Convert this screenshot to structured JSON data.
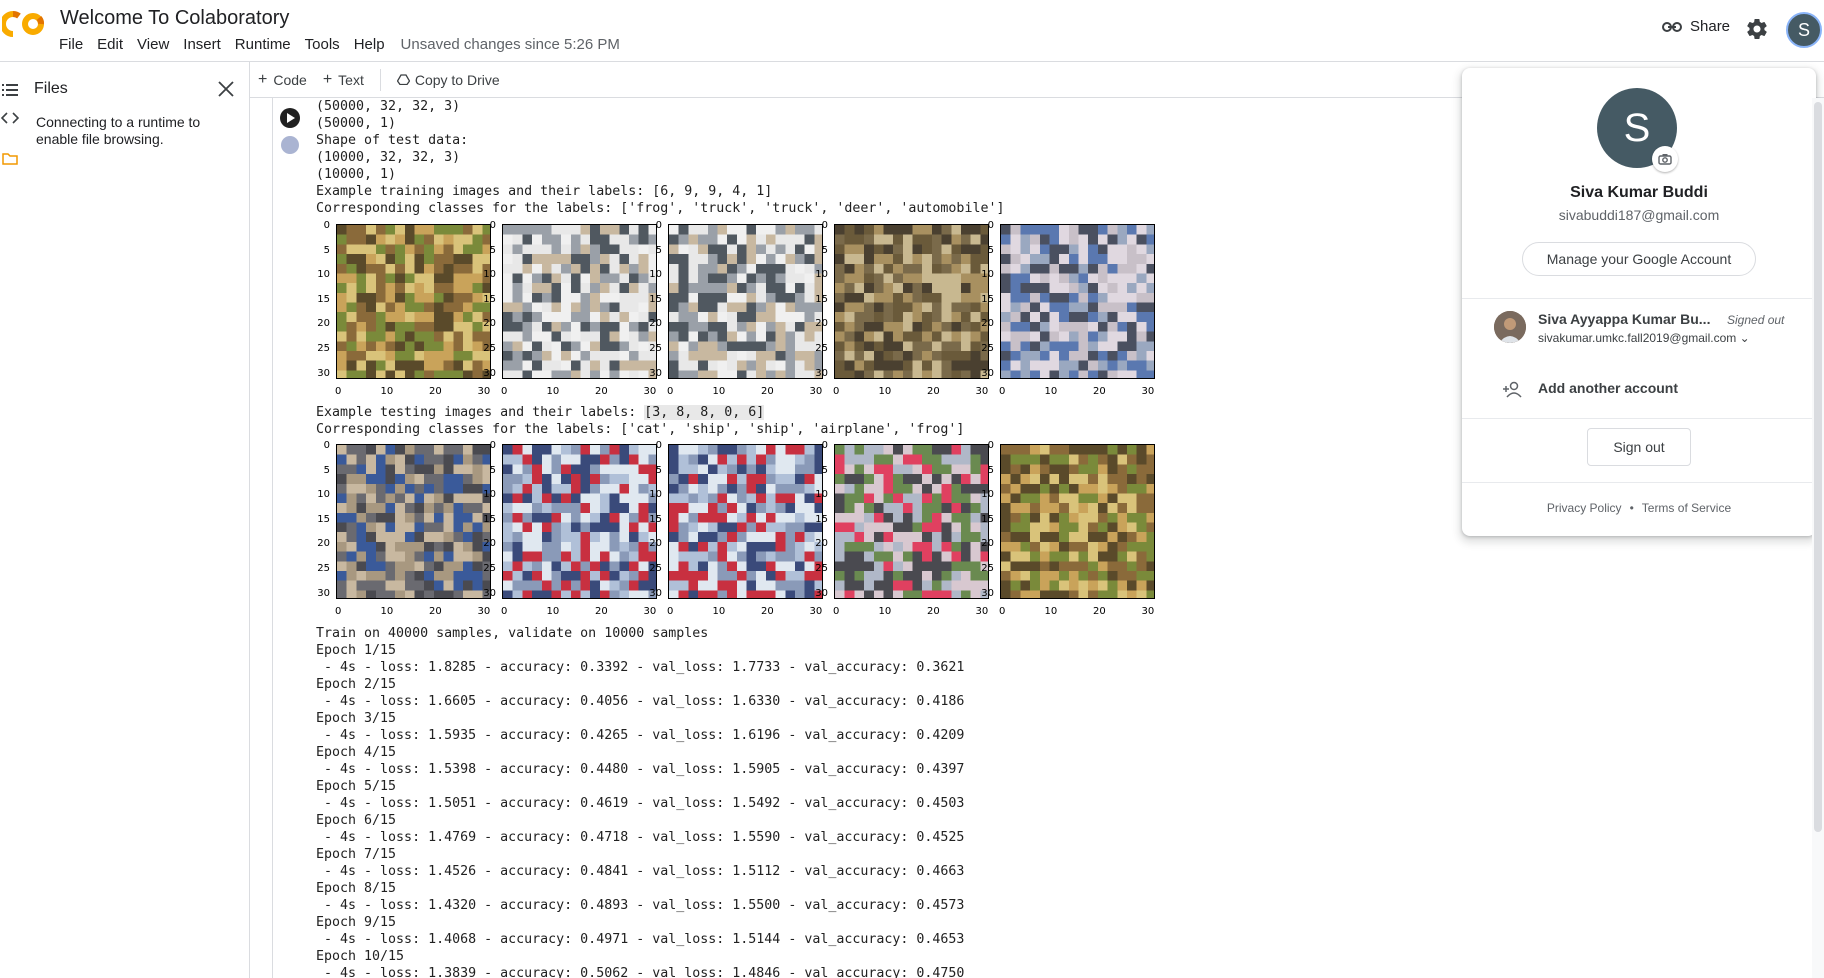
{
  "app": {
    "title": "Welcome To Colaboratory",
    "unsaved": "Unsaved changes since 5:26 PM",
    "share_label": "Share",
    "avatar_letter": "S",
    "accent_color": "#f9ab00"
  },
  "menu": [
    {
      "label": "File"
    },
    {
      "label": "Edit"
    },
    {
      "label": "View"
    },
    {
      "label": "Insert"
    },
    {
      "label": "Runtime"
    },
    {
      "label": "Tools"
    },
    {
      "label": "Help"
    }
  ],
  "sidebar": {
    "title": "Files",
    "message": "Connecting to a runtime to enable file browsing."
  },
  "toolbar": {
    "code_label": "Code",
    "text_label": "Text",
    "copy_label": "Copy to Drive"
  },
  "output": {
    "lines_top": [
      "(50000, 32, 32, 3)",
      "(50000, 1)",
      "Shape of test data:",
      "(10000, 32, 32, 3)",
      "(10000, 1)",
      "Example training images and their labels: [6, 9, 9, 4, 1]",
      "Corresponding classes for the labels: ['frog', 'truck', 'truck', 'deer', 'automobile']"
    ],
    "test_label_prefix": "Example testing images and their labels: ",
    "test_label_values": "[3, 8, 8, 0, 6]",
    "test_classes": "Corresponding classes for the labels: ['cat', 'ship', 'ship', 'airplane', 'frog']",
    "training_lines": [
      "Train on 40000 samples, validate on 10000 samples",
      "Epoch 1/15",
      " - 4s - loss: 1.8285 - accuracy: 0.3392 - val_loss: 1.7733 - val_accuracy: 0.3621",
      "Epoch 2/15",
      " - 4s - loss: 1.6605 - accuracy: 0.4056 - val_loss: 1.6330 - val_accuracy: 0.4186",
      "Epoch 3/15",
      " - 4s - loss: 1.5935 - accuracy: 0.4265 - val_loss: 1.6196 - val_accuracy: 0.4209",
      "Epoch 4/15",
      " - 4s - loss: 1.5398 - accuracy: 0.4480 - val_loss: 1.5905 - val_accuracy: 0.4397",
      "Epoch 5/15",
      " - 4s - loss: 1.5051 - accuracy: 0.4619 - val_loss: 1.5492 - val_accuracy: 0.4503",
      "Epoch 6/15",
      " - 4s - loss: 1.4769 - accuracy: 0.4718 - val_loss: 1.5590 - val_accuracy: 0.4525",
      "Epoch 7/15",
      " - 4s - loss: 1.4526 - accuracy: 0.4841 - val_loss: 1.5112 - val_accuracy: 0.4663",
      "Epoch 8/15",
      " - 4s - loss: 1.4320 - accuracy: 0.4893 - val_loss: 1.5500 - val_accuracy: 0.4573",
      "Epoch 9/15",
      " - 4s - loss: 1.4068 - accuracy: 0.4971 - val_loss: 1.5144 - val_accuracy: 0.4653",
      "Epoch 10/15",
      " - 4s - loss: 1.3839 - accuracy: 0.5062 - val_loss: 1.4846 - val_accuracy: 0.4750"
    ],
    "axis_ticks_y": [
      "0",
      "5",
      "10",
      "15",
      "20",
      "25",
      "30"
    ],
    "axis_ticks_x": [
      "0",
      "10",
      "20",
      "30"
    ],
    "train_images": [
      "frog",
      "truck",
      "truck",
      "deer",
      "automobile"
    ],
    "test_images": [
      "cat",
      "ship",
      "ship",
      "airplane",
      "frog"
    ]
  },
  "account": {
    "name": "Siva Kumar Buddi",
    "email": "sivabuddi187@gmail.com",
    "manage_label": "Manage your Google Account",
    "other_name": "Siva Ayyappa Kumar Bu...",
    "other_status": "Signed out",
    "other_email": "sivakumar.umkc.fall2019@gmail.com",
    "add_label": "Add another account",
    "signout_label": "Sign out",
    "privacy_label": "Privacy Policy",
    "dot": "•",
    "terms_label": "Terms of Service"
  }
}
